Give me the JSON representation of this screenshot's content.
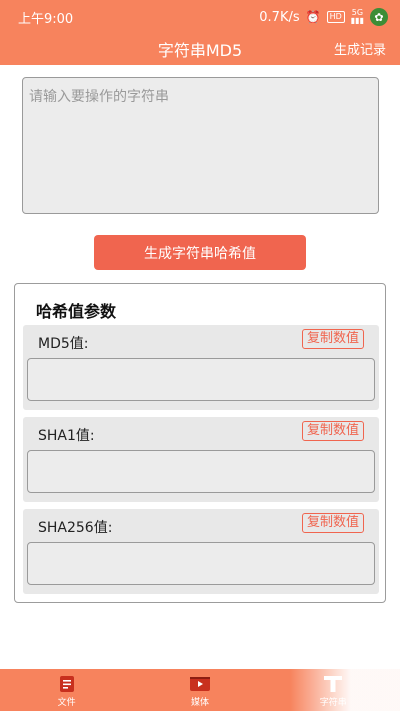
{
  "status_bar": {
    "time": "上午9:00",
    "speed": "0.7K/s",
    "hd": "HD",
    "signal": "5G"
  },
  "header": {
    "title": "字符串MD5",
    "action": "生成记录"
  },
  "input": {
    "placeholder": "请输入要操作的字符串",
    "value": ""
  },
  "generate_button": "生成字符串哈希值",
  "hash_panel": {
    "title": "哈希值参数",
    "items": [
      {
        "label": "MD5值:",
        "copy": "复制数值",
        "value": ""
      },
      {
        "label": "SHA1值:",
        "copy": "复制数值",
        "value": ""
      },
      {
        "label": "SHA256值:",
        "copy": "复制数值",
        "value": ""
      }
    ]
  },
  "bottom_nav": [
    {
      "label": "文件",
      "icon": "file-icon"
    },
    {
      "label": "媒体",
      "icon": "media-icon"
    },
    {
      "label": "字符串",
      "icon": "text-icon"
    }
  ],
  "colors": {
    "accent": "#f7835d",
    "button": "#f0654f"
  }
}
